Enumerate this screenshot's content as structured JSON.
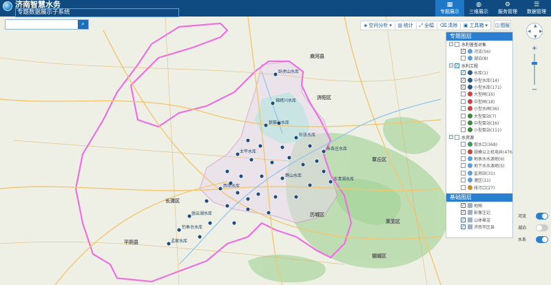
{
  "header": {
    "title": "济南智慧水务",
    "subtitle": "专题数据展示子系统",
    "nav": [
      {
        "label": "专题展示",
        "icon": "grid-icon",
        "active": true
      },
      {
        "label": "三维展示",
        "icon": "globe-icon",
        "active": false
      },
      {
        "label": "服务管理",
        "icon": "service-icon",
        "active": false
      },
      {
        "label": "数据管理",
        "icon": "database-icon",
        "active": false
      }
    ]
  },
  "search": {
    "placeholder": "",
    "value": ""
  },
  "toolbar": {
    "items": [
      {
        "label": "空间分析",
        "icon": "analysis-icon",
        "dropdown": true
      },
      {
        "label": "统计",
        "icon": "stats-icon",
        "dropdown": false
      },
      {
        "label": "全幅",
        "icon": "fullextent-icon",
        "dropdown": false
      },
      {
        "label": "清除",
        "icon": "clear-icon",
        "dropdown": false
      },
      {
        "label": "工具箱",
        "icon": "toolbox-icon",
        "dropdown": true
      }
    ],
    "legend_label": "图层"
  },
  "layer_panel": {
    "title1": "专题图层",
    "rows": [
      {
        "level": "grp",
        "label": "水利普查对象",
        "checked": false,
        "exp": "-",
        "color": ""
      },
      {
        "level": "sub",
        "label": "河流(56)",
        "checked": true,
        "color": "#5aa0e0"
      },
      {
        "level": "sub",
        "label": "湖泊(8)",
        "checked": false,
        "color": "#5aa0e0"
      },
      {
        "level": "grp",
        "label": "水利工程",
        "checked": true,
        "exp": "-",
        "color": ""
      },
      {
        "level": "sub",
        "label": "水库(1)",
        "checked": true,
        "color": "#2a5b8a"
      },
      {
        "level": "sub",
        "label": "中型水库(14)",
        "checked": true,
        "color": "#2a5b8a"
      },
      {
        "level": "sub",
        "label": "小型水库(171)",
        "checked": true,
        "color": "#2a5b8a"
      },
      {
        "level": "sub",
        "label": "大型闸(16)",
        "checked": false,
        "color": "#d04040"
      },
      {
        "level": "sub",
        "label": "中型闸(18)",
        "checked": false,
        "color": "#d04040"
      },
      {
        "level": "sub",
        "label": "小型水闸(36)",
        "checked": false,
        "color": "#d04040"
      },
      {
        "level": "sub",
        "label": "大型泵站(7)",
        "checked": false,
        "color": "#3a8a3a"
      },
      {
        "level": "sub",
        "label": "中型泵站(16)",
        "checked": false,
        "color": "#3a8a3a"
      },
      {
        "level": "sub",
        "label": "小型泵站(111)",
        "checked": false,
        "color": "#3a8a3a"
      },
      {
        "level": "grp",
        "label": "水资源",
        "checked": false,
        "exp": "-",
        "color": ""
      },
      {
        "level": "sub",
        "label": "取水口(368)",
        "checked": false,
        "color": "#3a9a5a"
      },
      {
        "level": "sub",
        "label": "规模以上机电井(4764)",
        "checked": false,
        "color": "#d04040"
      },
      {
        "level": "sub",
        "label": "地表水水源地(6)",
        "checked": false,
        "color": "#5aa0e0"
      },
      {
        "level": "sub",
        "label": "地下水水源地(5)",
        "checked": false,
        "color": "#5aa0e0"
      },
      {
        "level": "sub",
        "label": "监测站(31)",
        "checked": false,
        "color": "#5aa0e0"
      },
      {
        "level": "sub",
        "label": "灌区(11)",
        "checked": false,
        "color": "#5aa0e0"
      },
      {
        "level": "sub",
        "label": "排污口(27)",
        "checked": false,
        "color": "#d08a30"
      }
    ],
    "title2": "基础图层",
    "rows2": [
      {
        "label": "地图",
        "checked": true
      },
      {
        "label": "影像注记",
        "checked": true
      },
      {
        "label": "山体晕渲",
        "checked": true
      },
      {
        "label": "济南市区县",
        "checked": true
      }
    ]
  },
  "toggles": [
    {
      "label": "河流",
      "on": true
    },
    {
      "label": "湖泊",
      "on": false
    },
    {
      "label": "水系",
      "on": true
    }
  ],
  "map_labels": [
    "卧虎山水库",
    "锦绣川水库",
    "狼猫山水库",
    "杜张水库",
    "朱各庄水库",
    "太平水库",
    "西郊水库",
    "崮云湖水库",
    "钓鱼台水库",
    "孟家水库",
    "鹊山水库",
    "玉清湖水库",
    "济阳区",
    "章丘区",
    "长清区",
    "平阴县",
    "商河县",
    "莱芜区",
    "钢城区",
    "历城区"
  ]
}
